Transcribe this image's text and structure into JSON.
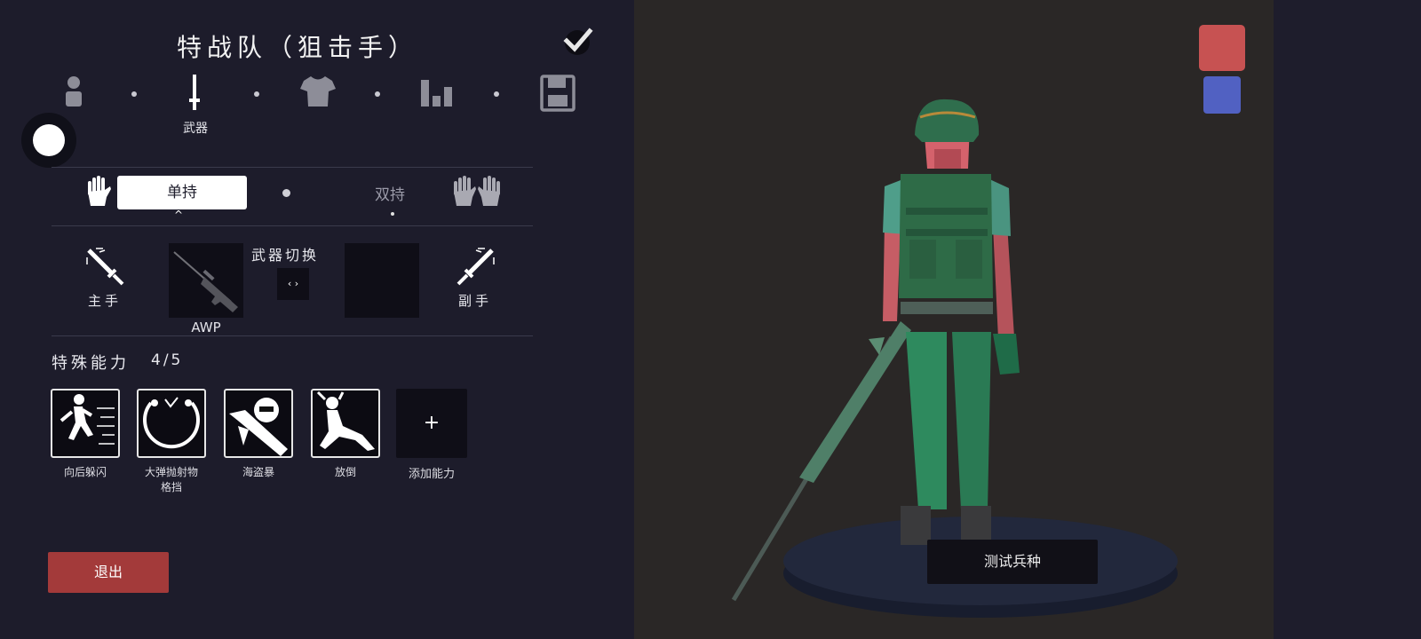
{
  "header": {
    "title": "特战队（狙击手）"
  },
  "tabs": [
    {
      "name": "unit-tab"
    },
    {
      "name": "weapon-tab",
      "label": "武器"
    },
    {
      "name": "clothing-tab"
    },
    {
      "name": "stats-tab"
    },
    {
      "name": "save-tab"
    }
  ],
  "grip": {
    "single_label": "单持",
    "dual_label": "双持"
  },
  "weapons": {
    "switch_label": "武器切换",
    "switch_glyph": "‹ ›",
    "main_hand_label": "主手",
    "off_hand_label": "副手",
    "main_weapon_name": "AWP"
  },
  "abilities": {
    "title": "特殊能力",
    "count": "4/5",
    "items": [
      {
        "label": "向后躲闪",
        "icon": "backstep-icon"
      },
      {
        "label": "大弹抛射物\n格挡",
        "icon": "projectile-block-icon"
      },
      {
        "label": "海盗暴",
        "icon": "pirate-rocket-icon"
      },
      {
        "label": "放倒",
        "icon": "knockdown-icon"
      }
    ],
    "add_label": "添加能力",
    "add_glyph": "+"
  },
  "footer": {
    "exit_label": "退出"
  },
  "viewport": {
    "test_label": "测试兵种",
    "team_colors": {
      "red": "#c75252",
      "blue": "#5161c2"
    }
  },
  "colors": {
    "panel_bg": "#1d1c2b",
    "accent_red": "#a33a3a"
  }
}
